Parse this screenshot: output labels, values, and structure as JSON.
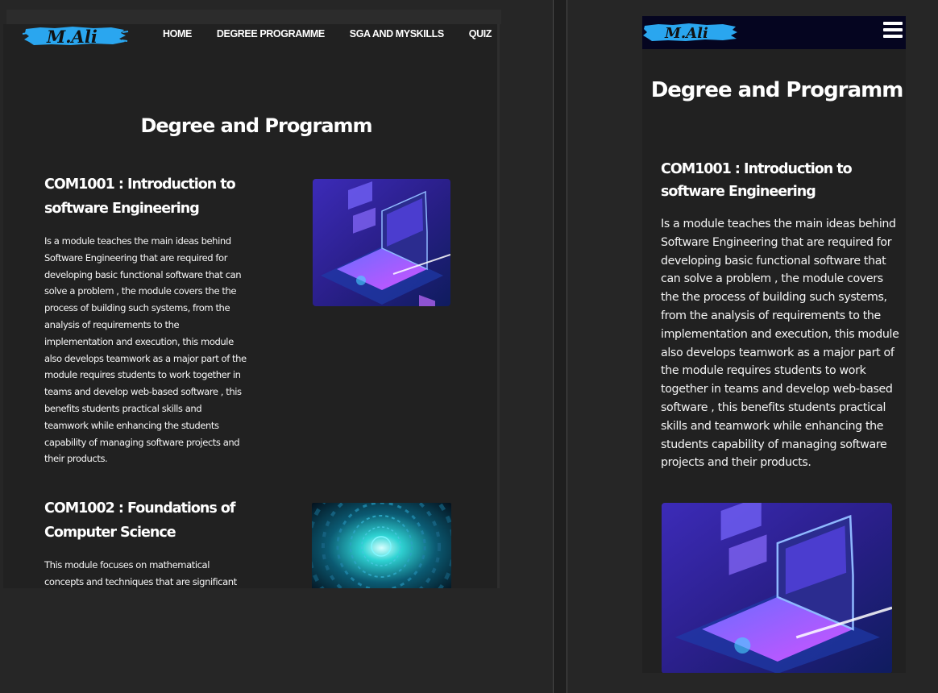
{
  "brand": {
    "logo_text": "M.Ali",
    "logo_color": "#2aa6ef"
  },
  "nav": {
    "items": [
      {
        "label": "HOME"
      },
      {
        "label": "DEGREE PROGRAMME"
      },
      {
        "label": "SGA AND MYSKILLS"
      },
      {
        "label": "QUIZ"
      }
    ]
  },
  "page": {
    "title": "Degree and Programm"
  },
  "modules": [
    {
      "title": "COM1001 : Introduction to software Engineering",
      "description": "Is a module teaches the main ideas behind Software Engineering that are required for developing basic functional software that can solve a problem , the module covers the the process of building such systems, from the analysis of requirements to the implementation and execution, this module also develops teamwork as a major part of the module requires students to work together in teams and develop web-based software , this benefits students practical skills and teamwork while enhancing the students capability of managing software projects and their products.",
      "image": "isometric-laptop-illustration"
    },
    {
      "title": "COM1002 : Foundations of Computer Science",
      "description": "This module focuses on mathematical concepts and techniques that are significant to",
      "image": "binary-tunnel-illustration"
    }
  ],
  "mobile": {
    "menu_icon": "hamburger-menu-icon"
  },
  "colors": {
    "page_bg": "#262626",
    "panel_bg": "#212121",
    "mobile_header_bg": "#050520",
    "text": "#ffffff"
  }
}
